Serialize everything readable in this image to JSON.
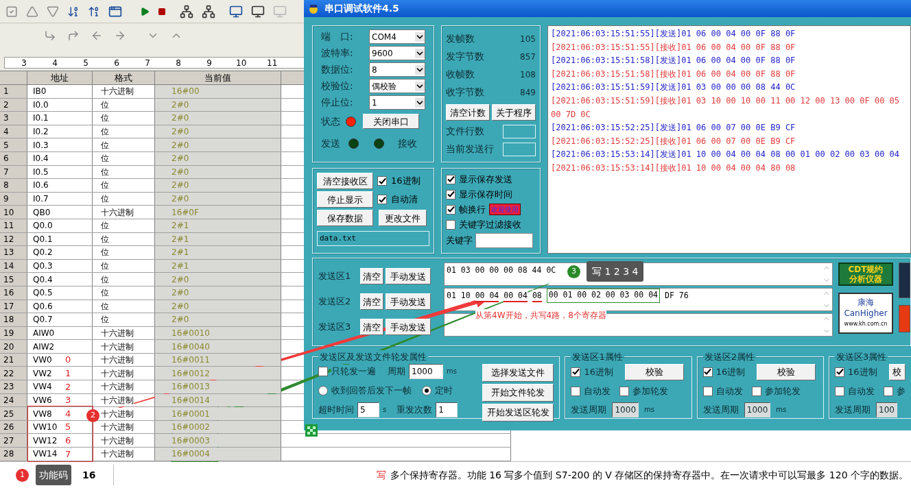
{
  "ruler": {
    "ticks": [
      "3",
      "4",
      "5",
      "6",
      "7",
      "8",
      "9",
      "10",
      "11"
    ]
  },
  "table": {
    "columns": [
      "地址",
      "格式",
      "当前值"
    ],
    "rows": [
      {
        "index": "1",
        "address": "IB0",
        "format": "十六进制",
        "value": "16#00"
      },
      {
        "index": "2",
        "address": "I0.0",
        "format": "位",
        "value": "2#0"
      },
      {
        "index": "3",
        "address": "I0.1",
        "format": "位",
        "value": "2#0"
      },
      {
        "index": "4",
        "address": "I0.2",
        "format": "位",
        "value": "2#0"
      },
      {
        "index": "5",
        "address": "I0.3",
        "format": "位",
        "value": "2#0"
      },
      {
        "index": "6",
        "address": "I0.4",
        "format": "位",
        "value": "2#0"
      },
      {
        "index": "7",
        "address": "I0.5",
        "format": "位",
        "value": "2#0"
      },
      {
        "index": "8",
        "address": "I0.6",
        "format": "位",
        "value": "2#0"
      },
      {
        "index": "9",
        "address": "I0.7",
        "format": "位",
        "value": "2#0"
      },
      {
        "index": "10",
        "address": "QB0",
        "format": "十六进制",
        "value": "16#0F"
      },
      {
        "index": "11",
        "address": "Q0.0",
        "format": "位",
        "value": "2#1"
      },
      {
        "index": "12",
        "address": "Q0.1",
        "format": "位",
        "value": "2#1"
      },
      {
        "index": "13",
        "address": "Q0.2",
        "format": "位",
        "value": "2#1"
      },
      {
        "index": "14",
        "address": "Q0.3",
        "format": "位",
        "value": "2#1"
      },
      {
        "index": "15",
        "address": "Q0.4",
        "format": "位",
        "value": "2#0"
      },
      {
        "index": "16",
        "address": "Q0.5",
        "format": "位",
        "value": "2#0"
      },
      {
        "index": "17",
        "address": "Q0.6",
        "format": "位",
        "value": "2#0"
      },
      {
        "index": "18",
        "address": "Q0.7",
        "format": "位",
        "value": "2#0"
      },
      {
        "index": "19",
        "address": "AIW0",
        "format": "十六进制",
        "value": "16#0010"
      },
      {
        "index": "20",
        "address": "AIW2",
        "format": "十六进制",
        "value": "16#0040"
      },
      {
        "index": "21",
        "address": "VW0",
        "format": "十六进制",
        "value": "16#0011",
        "mark": "0"
      },
      {
        "index": "22",
        "address": "VW2",
        "format": "十六进制",
        "value": "16#0012",
        "mark": "1"
      },
      {
        "index": "23",
        "address": "VW4",
        "format": "十六进制",
        "value": "16#0013",
        "mark": "2"
      },
      {
        "index": "24",
        "address": "VW6",
        "format": "十六进制",
        "value": "16#0014",
        "mark": "3"
      },
      {
        "index": "25",
        "address": "VW8",
        "format": "十六进制",
        "value": "16#0001",
        "mark": "4"
      },
      {
        "index": "26",
        "address": "VW10",
        "format": "十六进制",
        "value": "16#0002",
        "mark": "5"
      },
      {
        "index": "27",
        "address": "VW12",
        "format": "十六进制",
        "value": "16#0003",
        "mark": "6"
      },
      {
        "index": "28",
        "address": "VW14",
        "format": "十六进制",
        "value": "16#0004",
        "mark": "7"
      }
    ]
  },
  "serial_window": {
    "title": "串口调试软件4.5",
    "port_settings": [
      {
        "label": "端　口:",
        "value": "COM4"
      },
      {
        "label": "波特率:",
        "value": "9600"
      },
      {
        "label": "数据位:",
        "value": "8"
      },
      {
        "label": "校验位:",
        "value": "偶校验"
      },
      {
        "label": "停止位:",
        "value": "1"
      }
    ],
    "status": {
      "label": "状态",
      "on": true
    },
    "close_button": "关闭串口",
    "send_led": {
      "label": "发送",
      "on": false
    },
    "receive_led": {
      "label": "接收",
      "on": false
    },
    "counters": [
      {
        "label": "发帧数",
        "value": "105"
      },
      {
        "label": "发字节数",
        "value": "857"
      },
      {
        "label": "收帧数",
        "value": "108"
      },
      {
        "label": "收字节数",
        "value": "849"
      }
    ],
    "counter_buttons": [
      "清空计数",
      "关于程序"
    ],
    "file_fields": [
      {
        "label": "文件行数"
      },
      {
        "label": "当前发送行"
      }
    ],
    "receive_controls": {
      "buttons": [
        "清空接收区",
        "停止显示",
        "保存数据",
        "更改文件"
      ],
      "options": [
        {
          "label": "16进制",
          "checked": true
        },
        {
          "label": "自动清",
          "checked": true
        }
      ],
      "file": "data.txt"
    },
    "display_options": [
      {
        "label": "显示保存发送",
        "checked": true
      },
      {
        "label": "显示保存时间",
        "checked": true
      },
      {
        "label": "帧换行",
        "checked": true,
        "badge": "欢迎使用"
      },
      {
        "label": "关键字过滤接收",
        "checked": false
      }
    ],
    "keyword": {
      "label": "关键字"
    },
    "log": [
      {
        "kind": "send",
        "text": "[2021:06:03:15:51:55][发送]01 06 00 04 00 0F 88 0F"
      },
      {
        "kind": "receive",
        "text": "[2021:06:03:15:51:55][接收]01 06 00 04 00 0F 88 0F"
      },
      {
        "kind": "send",
        "text": "[2021:06:03:15:51:58][发送]01 06 00 04 00 0F 88 0F"
      },
      {
        "kind": "receive",
        "text": "[2021:06:03:15:51:58][接收]01 06 00 04 00 0F 88 0F"
      },
      {
        "kind": "send",
        "text": "[2021:06:03:15:51:59][发送]01 03 00 00 00 08 44 0C"
      },
      {
        "kind": "receive",
        "text": "[2021:06:03:15:51:59][接收]01 03 10 00 10 00 11 00 12 00 13 00 0F 00 05 00 7D 0C"
      },
      {
        "kind": "send",
        "text": "[2021:06:03:15:52:25][发送]01 06 00 07 00 0E B9 CF"
      },
      {
        "kind": "receive",
        "text": "[2021:06:03:15:52:25][接收]01 06 00 07 00 0E B9 CF"
      },
      {
        "kind": "send",
        "text": "[2021:06:03:15:53:14][发送]01 10 00 04 00 04 08 00 01 00 02 00 03 00 04"
      },
      {
        "kind": "receive",
        "text": "[2021:06:03:15:53:14][接收]01 10 00 04 00 04 80 08"
      }
    ],
    "send_areas": [
      {
        "label": "发送区1",
        "clear": "清空",
        "send": "手动发送",
        "segments": [
          {
            "text": "01 03 00 00 00 08 44 0C",
            "kind": "plain"
          }
        ]
      },
      {
        "label": "发送区2",
        "clear": "清空",
        "send": "手动发送",
        "segments": [
          {
            "text": "01 10",
            "kind": "plain"
          },
          {
            "text": "00 04",
            "kind": "underline"
          },
          {
            "text": "00 04",
            "kind": "underline"
          },
          {
            "text": "08",
            "kind": "underline"
          },
          {
            "text": "00 01 00 02 00 03 00 04",
            "kind": "frame"
          },
          {
            "text": "DF 76",
            "kind": "plain"
          }
        ]
      },
      {
        "label": "发送区3",
        "clear": "清空",
        "send": "手动发送"
      }
    ],
    "logos": [
      {
        "kind": "cdt",
        "lines": [
          "CDT规约",
          "分析仪器"
        ]
      },
      {
        "kind": "canhigher",
        "lines": [
          "康海",
          "CanHigher",
          "www.kh.com.cn"
        ]
      }
    ],
    "cycle_group": {
      "title": "发送区及发送文件轮发属性",
      "once": {
        "label": "只轮发一遍",
        "checked": false
      },
      "period": {
        "label": "周期",
        "value": "1000",
        "unit": "ms"
      },
      "modes": [
        {
          "label": "收到回答后发下一帧",
          "selected": false
        },
        {
          "label": "定时",
          "selected": true
        }
      ],
      "timeout": {
        "label": "超时时间",
        "value": "5",
        "unit": "s"
      },
      "retries": {
        "label": "重发次数",
        "value": "1"
      },
      "buttons": [
        "选择发送文件",
        "开始文件轮发",
        "开始发送区轮发"
      ]
    },
    "area_groups": [
      {
        "title": "发送区1属性",
        "hex": {
          "label": "16进制",
          "checked": true
        },
        "check_button": "校验",
        "auto": {
          "label": "自动发",
          "checked": false
        },
        "join": {
          "label": "参加轮发",
          "checked": false
        },
        "period": {
          "label": "发送周期",
          "value": "1000",
          "unit": "ms",
          "disabled": true
        }
      },
      {
        "title": "发送区2属性",
        "hex": {
          "label": "16进制",
          "checked": true
        },
        "check_button": "校验",
        "auto": {
          "label": "自动发",
          "checked": false
        },
        "join": {
          "label": "参加轮发",
          "checked": false
        },
        "period": {
          "label": "发送周期",
          "value": "1000",
          "unit": "ms",
          "disabled": true
        }
      },
      {
        "title": "发送区3属性",
        "hex": {
          "label": "16进制",
          "checked": true
        },
        "check_button": "校",
        "auto": {
          "label": "自动发",
          "checked": false
        },
        "join": {
          "label": "参",
          "checked": false
        },
        "period": {
          "label": "发送周期",
          "value": "100",
          "disabled": true
        }
      }
    ]
  },
  "annotations": {
    "badge_2": "2",
    "badge_3": "3",
    "tooltip_3": "写 1 2 3 4",
    "note": "从第4W开始，共写4路，8个寄存器"
  },
  "status_bar": {
    "badge": "1",
    "label": "功能码",
    "value": "16",
    "lead": "写",
    "description": "多个保持寄存器。功能 16 写多个值到 S7-200 的 V 存储区的保持寄存器中。在一次请求中可以写最多 120 个字的数据。"
  }
}
